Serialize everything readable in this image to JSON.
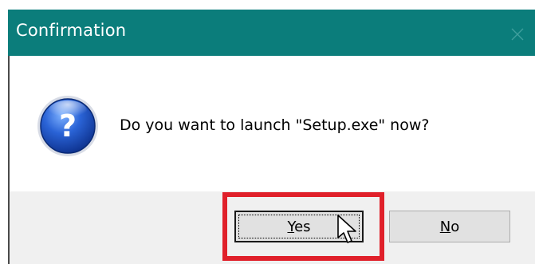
{
  "window": {
    "title": "Confirmation",
    "title_bar_color": "#0b7d7b"
  },
  "dialog": {
    "message": "Do you want to launch \"Setup.exe\" now?",
    "icon": "question-icon",
    "icon_glyph": "?"
  },
  "buttons": {
    "yes": {
      "mnemonic": "Y",
      "rest": "es"
    },
    "no": {
      "mnemonic": "N",
      "rest": "o"
    }
  },
  "annotation": {
    "highlight_color": "#e0202a"
  }
}
